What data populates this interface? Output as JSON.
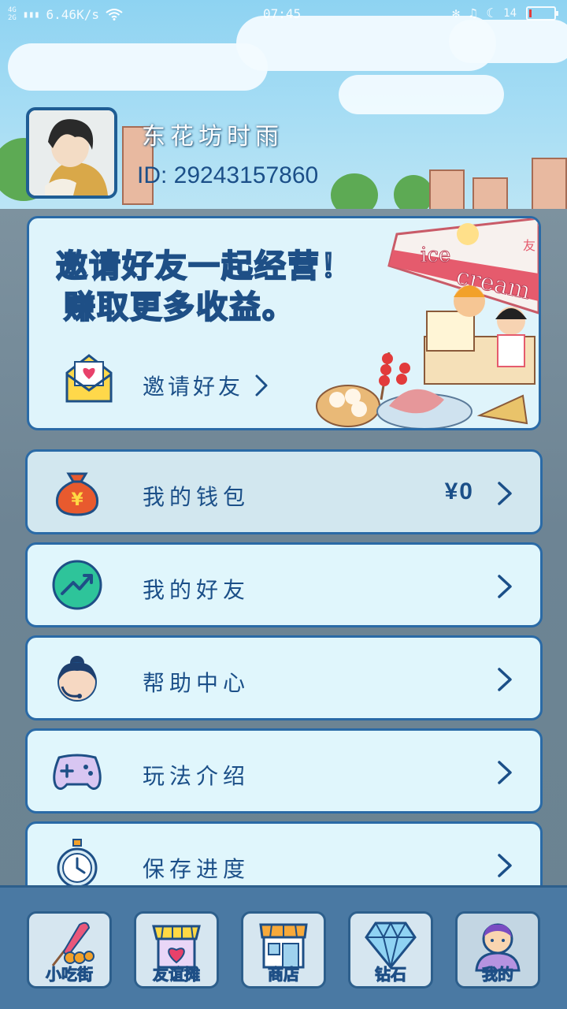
{
  "status_bar": {
    "network_top": "4G",
    "network_bottom": "2G",
    "speed": "6.46K/s",
    "time": "07:45",
    "battery": "14"
  },
  "profile": {
    "username": "东花坊时雨",
    "id_text": "ID: 29243157860"
  },
  "invite_card": {
    "headline": "邀请好友一起经营！",
    "subheadline": "赚取更多收益。",
    "link_label": "邀请好友",
    "shop_sign_top": "ice",
    "shop_sign_bottom": "cream",
    "shop_flag": "友"
  },
  "menu": {
    "wallet": {
      "label": "我的钱包",
      "value": "¥0"
    },
    "friends": {
      "label": "我的好友"
    },
    "help": {
      "label": "帮助中心"
    },
    "howto": {
      "label": "玩法介绍"
    },
    "save": {
      "label": "保存进度"
    }
  },
  "bottom_nav": {
    "tabs": [
      {
        "label": "小吃街",
        "icon": "skewer-icon"
      },
      {
        "label": "友谊摊",
        "icon": "stall-heart-icon"
      },
      {
        "label": "商店",
        "icon": "store-icon"
      },
      {
        "label": "钻石",
        "icon": "diamond-icon"
      },
      {
        "label": "我的",
        "icon": "profile-icon"
      }
    ]
  },
  "colors": {
    "primary": "#1b4f88",
    "card_bg": "#e0f6fc",
    "nav_bg": "#4a79a3",
    "highlight_yellow": "#ffd944"
  }
}
